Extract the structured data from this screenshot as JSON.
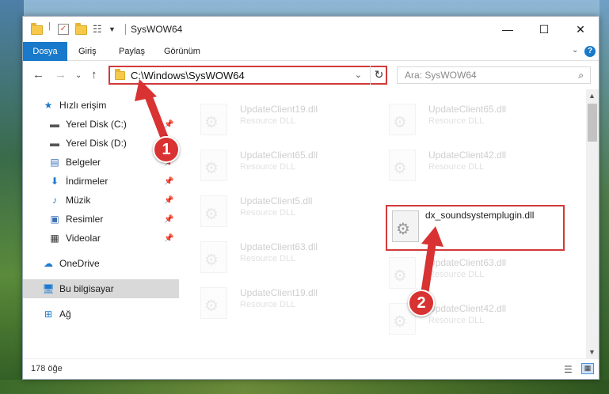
{
  "window": {
    "title": "SysWOW64",
    "controls": {
      "minimize": "—",
      "maximize": "☐",
      "close": "✕"
    }
  },
  "ribbon": {
    "tabs": [
      {
        "label": "Dosya",
        "active": true
      },
      {
        "label": "Giriş"
      },
      {
        "label": "Paylaş"
      },
      {
        "label": "Görünüm"
      }
    ],
    "help": "?"
  },
  "address": {
    "path": "C:\\Windows\\SysWOW64",
    "search_placeholder": "Ara: SysWOW64"
  },
  "sidebar": {
    "items": [
      {
        "label": "Hızlı erişim",
        "icon": "star-icon",
        "pinned": false
      },
      {
        "label": "Yerel Disk (C:)",
        "icon": "drive-icon",
        "pinned": true
      },
      {
        "label": "Yerel Disk (D:)",
        "icon": "drive-icon",
        "pinned": false
      },
      {
        "label": "Belgeler",
        "icon": "document-icon",
        "pinned": true
      },
      {
        "label": "İndirmeler",
        "icon": "download-icon",
        "pinned": true
      },
      {
        "label": "Müzik",
        "icon": "music-icon",
        "pinned": true
      },
      {
        "label": "Resimler",
        "icon": "pictures-icon",
        "pinned": true
      },
      {
        "label": "Videolar",
        "icon": "video-icon",
        "pinned": true
      },
      {
        "label": "OneDrive",
        "icon": "cloud-icon",
        "pinned": false
      },
      {
        "label": "Bu bilgisayar",
        "icon": "computer-icon",
        "pinned": false,
        "selected": true
      },
      {
        "label": "Ağ",
        "icon": "network-icon",
        "pinned": false
      }
    ]
  },
  "files": {
    "items": [
      {
        "name": "UpdateClient19.dll",
        "desc": "Resource DLL"
      },
      {
        "name": "UpdateClient65.dll",
        "desc": "Resource DLL"
      },
      {
        "name": "UpdateClient65.dll",
        "desc": "Resource DLL"
      },
      {
        "name": "UpdateClient42.dll",
        "desc": "Resource DLL"
      },
      {
        "name": "UpdateClient5.dll",
        "desc": "Resource DLL"
      },
      {
        "name": "dx_soundsystemplugin.dll",
        "desc": "",
        "highlighted": true
      },
      {
        "name": "UpdateClient63.dll",
        "desc": "Resource DLL"
      },
      {
        "name": "UpdateClient63.dll",
        "desc": "Resource DLL"
      },
      {
        "name": "UpdateClient19.dll",
        "desc": "Resource DLL"
      },
      {
        "name": "UpdateClient42.dll",
        "desc": "Resource DLL"
      }
    ]
  },
  "status": {
    "count": "178 öğe"
  },
  "annotations": {
    "step1": "1",
    "step2": "2",
    "color": "#d93232"
  }
}
